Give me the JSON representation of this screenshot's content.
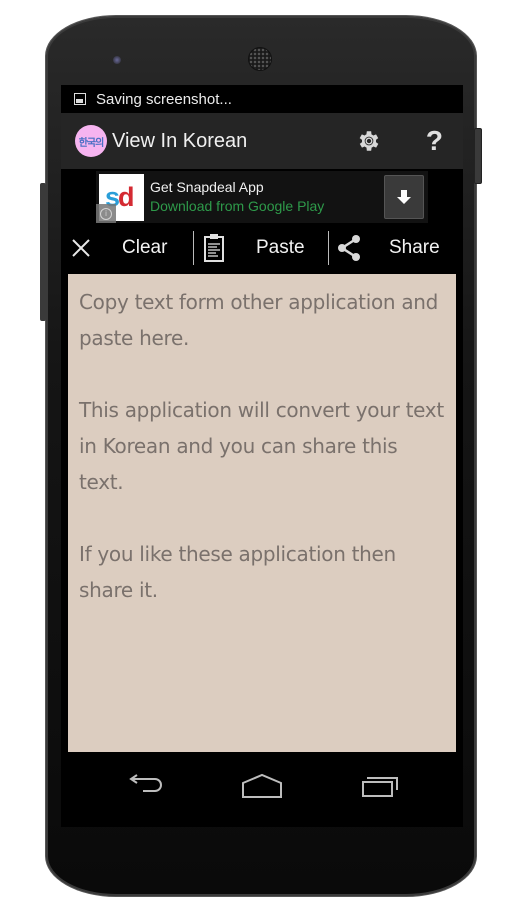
{
  "status_bar": {
    "icon": "image-icon",
    "text": "Saving screenshot..."
  },
  "action_bar": {
    "logo_text": "한국의",
    "title": "View In Korean",
    "settings_icon": "gear-icon",
    "help_label": "?"
  },
  "ad": {
    "logo_s": "s",
    "logo_d": "d",
    "info_label": "i",
    "title": "Get Snapdeal App",
    "subtitle": "Download from Google Play",
    "download_icon": "download-arrow-icon"
  },
  "toolbar": {
    "clear_label": "Clear",
    "paste_label": "Paste",
    "share_label": "Share"
  },
  "editor": {
    "text": "Copy text form other application and paste here.\n\nThis application will convert your text in Korean and you can share this text.\n\nIf you like these application then share it."
  },
  "nav": {
    "back": "back-icon",
    "home": "home-icon",
    "recents": "recents-icon"
  },
  "colors": {
    "editor_bg": "#dccdc0",
    "editor_text": "#7a716c",
    "ad_subtitle": "#2e9a4a",
    "action_bar_bg": "#252525",
    "logo_bg": "#f6b4f0"
  }
}
